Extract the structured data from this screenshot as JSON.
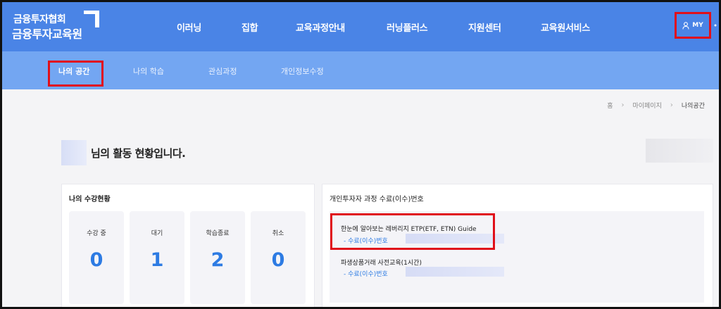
{
  "header": {
    "logo_line1": "금융투자협회",
    "logo_line2": "금융투자교육원",
    "nav": [
      "이러닝",
      "집합",
      "교육과정안내",
      "러닝플러스",
      "지원센터",
      "교육원서비스"
    ],
    "my_label": "MY"
  },
  "subnav": {
    "items": [
      "나의 공간",
      "나의 학습",
      "관심과정",
      "개인정보수정"
    ]
  },
  "breadcrumb": {
    "home": "홈",
    "mypage": "마이페이지",
    "current": "나의공간"
  },
  "greeting": {
    "text": "님의 활동 현황입니다."
  },
  "enrollment": {
    "title": "나의 수강현황",
    "stats": [
      {
        "label": "수강 중",
        "value": "0"
      },
      {
        "label": "대기",
        "value": "1"
      },
      {
        "label": "학습종료",
        "value": "2"
      },
      {
        "label": "취소",
        "value": "0"
      }
    ]
  },
  "certificates": {
    "title": "개인투자자 과정 수료(이수)번호",
    "items": [
      {
        "course": "한눈에 알아보는 레버리지 ETP(ETF, ETN) Guide",
        "label": "- 수료(이수)번호"
      },
      {
        "course": "파생상품거래 사전교육(1시간)",
        "label": "- 수료(이수)번호"
      }
    ]
  },
  "colors": {
    "header_bg": "#4a84e6",
    "subnav_bg": "#73a6f2",
    "accent": "#2d7be3",
    "highlight": "#e0101a"
  }
}
